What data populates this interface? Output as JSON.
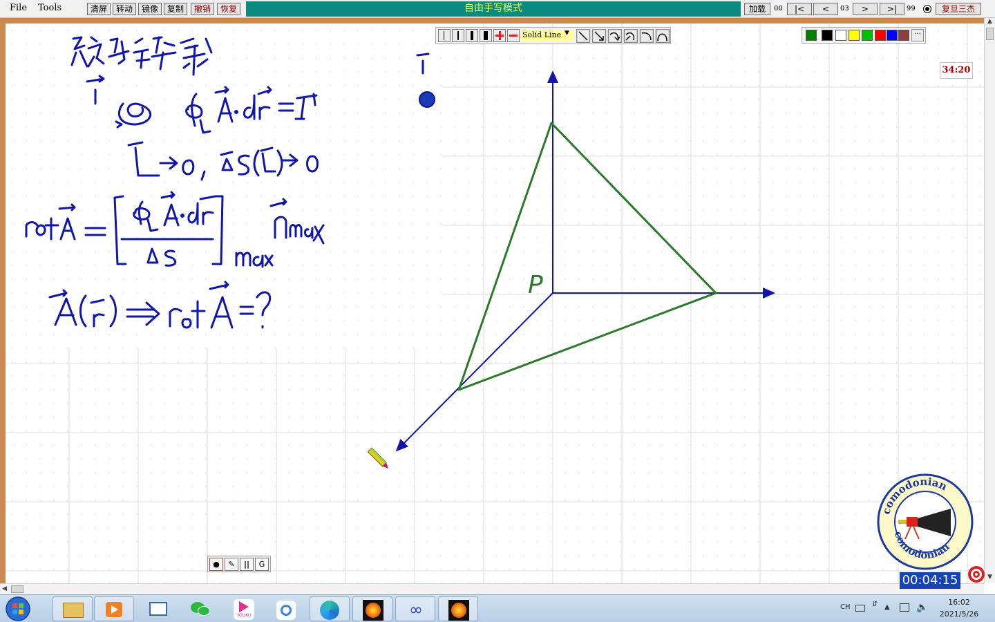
{
  "menu": {
    "file": "File",
    "tools": "Tools"
  },
  "toolbar": {
    "buttons": [
      "清屏",
      "转动",
      "镜像",
      "复制",
      "撤销",
      "恢复"
    ],
    "mode_banner": "自由手写模式",
    "load_label": "加载",
    "page_start": "00",
    "page_current": "03",
    "page_end": "99",
    "first_label": "|<",
    "prev_label": "<",
    "next_label": ">",
    "last_label": ">|",
    "course_label": "复旦三杰"
  },
  "pen_toolbar": {
    "line_style": "Solid Line",
    "tools": [
      "pen-thin-icon",
      "pen-medium-icon",
      "pen-thick-icon",
      "pen-bold-icon",
      "zoom-in-icon",
      "zoom-out-icon",
      "line-icon",
      "arrow-line-icon",
      "curve-arrow-icon",
      "curve-arrow-2-icon",
      "arc-icon",
      "bell-arc-icon"
    ]
  },
  "palette": {
    "colors": [
      "#008000",
      "#000000",
      "#ffffff",
      "#ffff00",
      "#00c000",
      "#ff0000",
      "#0000ff",
      "#8b4040"
    ],
    "more_label": "···"
  },
  "board": {
    "timer": "34:20",
    "ink_color": "#1016a8",
    "shape_color": "#2a7a2a",
    "point_label": "P"
  },
  "mini_toolbar": {
    "g_label": "G",
    "pause_label": "||"
  },
  "logo": {
    "text": "comodonian"
  },
  "recording": {
    "elapsed": "00:04:15"
  },
  "taskbar": {
    "apps": [
      "file-explorer-icon",
      "media-player-icon",
      "window-icon",
      "wechat-icon",
      "youku-icon",
      "network-icon",
      "edge-icon",
      "sun-app-icon",
      "infinity-icon",
      "sun-app-2-icon"
    ],
    "youku_label": "YOUKU",
    "tray_ch": "CH",
    "time": "16:02",
    "date": "2021/5/26"
  }
}
